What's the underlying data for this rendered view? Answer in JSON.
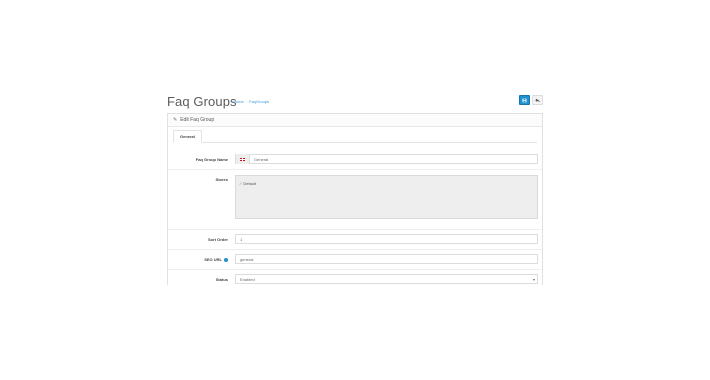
{
  "header": {
    "title": "Faq Groups",
    "breadcrumbs": [
      "Home",
      "FaqGroups"
    ],
    "save_icon": "save-icon",
    "back_icon": "reply-icon"
  },
  "panel": {
    "heading": "Edit Faq Group",
    "heading_icon": "pencil-icon"
  },
  "tabs": [
    {
      "label": "General"
    }
  ],
  "form": {
    "group_name_label": "Faq Group Name",
    "group_name_value": "General",
    "group_name_flag": "uk-flag-icon",
    "stores_label": "Stores",
    "stores_items": [
      "Default"
    ],
    "sort_order_label": "Sort Order",
    "sort_order_value": "1",
    "seo_url_label": "SEO URL",
    "seo_url_value": "general",
    "status_label": "Status",
    "status_value": "Enabled"
  },
  "colors": {
    "primary": "#1e91cf",
    "flag_red": "#c8102e"
  }
}
